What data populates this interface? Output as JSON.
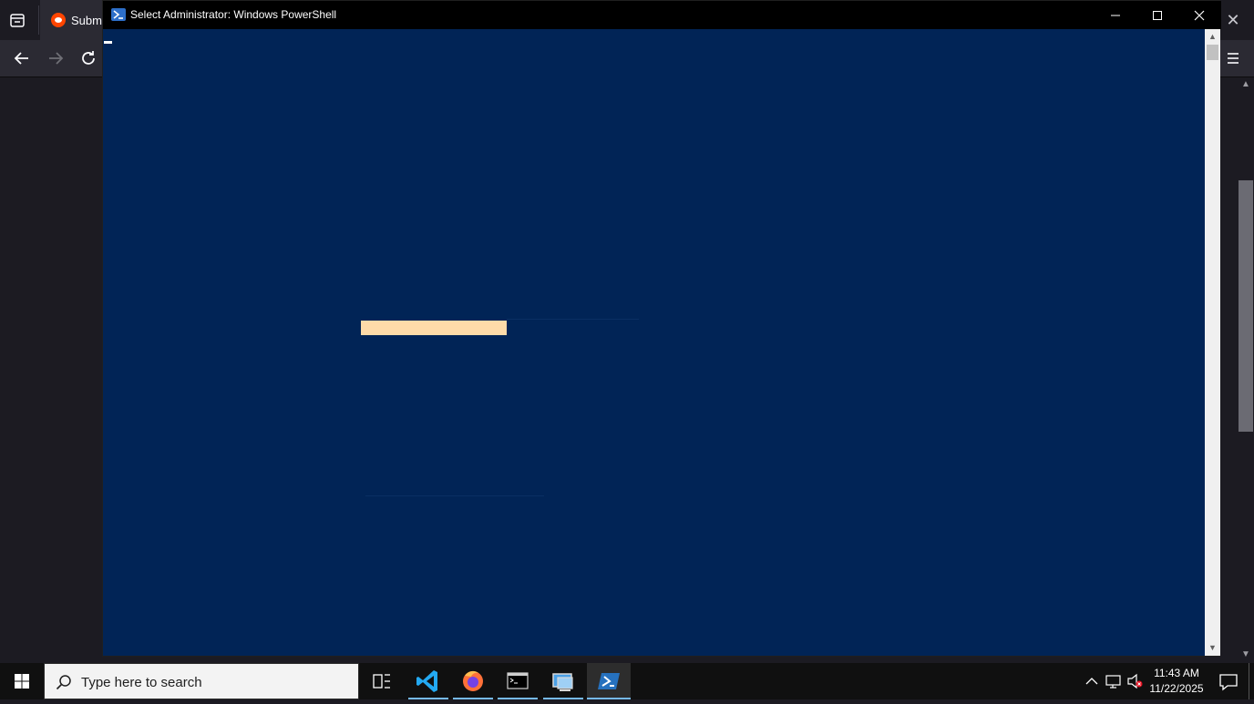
{
  "browser": {
    "tab_title": "Submi",
    "colors": {
      "background": "#1c1b22",
      "toolbar": "#2b2a33"
    }
  },
  "powershell": {
    "title": "Select Administrator: Windows PowerShell",
    "colors": {
      "console_bg": "#012456",
      "selection": "#fedba9",
      "titlebar": "#000000"
    }
  },
  "taskbar": {
    "search_placeholder": "Type here to search",
    "apps": [
      {
        "name": "task-view-icon"
      },
      {
        "name": "vscode-icon"
      },
      {
        "name": "firefox-icon"
      },
      {
        "name": "terminal-icon"
      },
      {
        "name": "remote-desktop-icon"
      },
      {
        "name": "powershell-icon",
        "active": true
      }
    ],
    "clock": {
      "time": "11:43 AM",
      "date": "11/22/2025"
    }
  }
}
